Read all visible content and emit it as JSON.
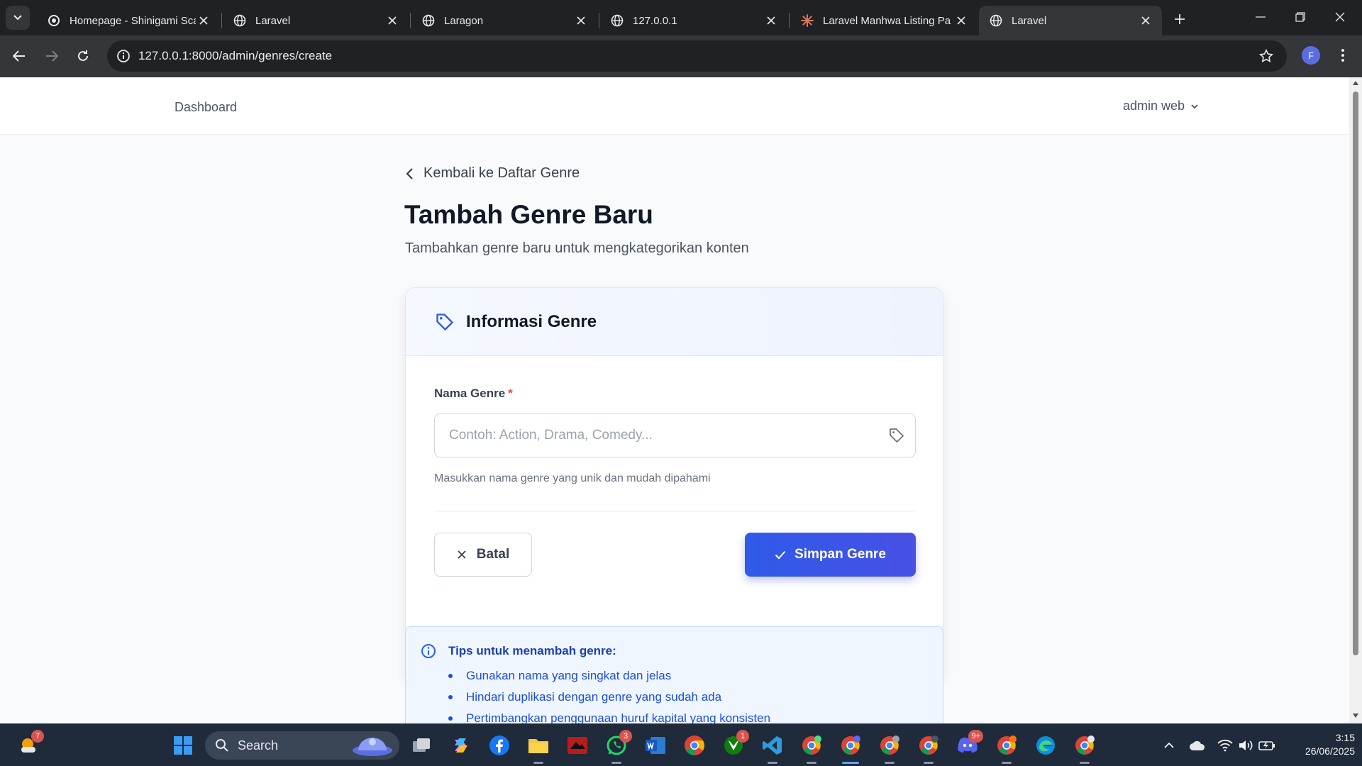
{
  "browser": {
    "tabs": [
      {
        "title": "Homepage - Shinigami Sca",
        "favicon": "shinigami-icon",
        "active": false
      },
      {
        "title": "Laravel",
        "favicon": "globe-icon",
        "active": false
      },
      {
        "title": "Laragon",
        "favicon": "globe-icon",
        "active": false
      },
      {
        "title": "127.0.0.1",
        "favicon": "globe-icon",
        "active": false
      },
      {
        "title": "Laravel Manhwa Listing Pa",
        "favicon": "claude-icon",
        "active": false
      },
      {
        "title": "Laravel",
        "favicon": "globe-icon",
        "active": true
      }
    ],
    "url": "127.0.0.1:8000/admin/genres/create",
    "profile_initial": "F"
  },
  "nav": {
    "dashboard_label": "Dashboard",
    "user_label": "admin web"
  },
  "page": {
    "back_label": "Kembali ke Daftar Genre",
    "title": "Tambah Genre Baru",
    "subtitle": "Tambahkan genre baru untuk mengkategorikan konten"
  },
  "form": {
    "card_title": "Informasi Genre",
    "field_label": "Nama Genre",
    "required_mark": "*",
    "placeholder": "Contoh: Action, Drama, Comedy...",
    "value": "",
    "help": "Masukkan nama genre yang unik dan mudah dipahami",
    "cancel_label": "Batal",
    "submit_label": "Simpan Genre"
  },
  "tips": {
    "title": "Tips untuk menambah genre:",
    "items": [
      "Gunakan nama yang singkat dan jelas",
      "Hindari duplikasi dengan genre yang sudah ada",
      "Pertimbangkan penggunaan huruf kapital yang konsisten"
    ]
  },
  "taskbar": {
    "search_label": "Search",
    "weather_badge": "7",
    "whatsapp_badge": "3",
    "xbox_badge": "1",
    "discord_badge": "9+",
    "time": "3:15",
    "date": "26/06/2025"
  },
  "colors": {
    "primary": "#3b5bdb",
    "required": "#ef4444",
    "tips_text": "#1d4ed8",
    "browser_bg": "#202124"
  }
}
